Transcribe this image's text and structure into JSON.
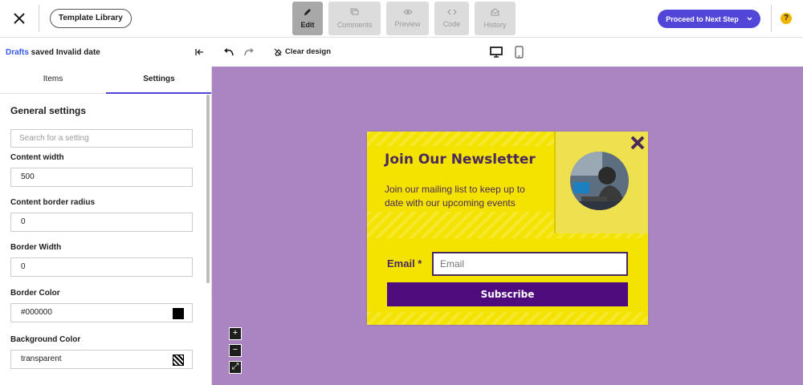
{
  "header": {
    "template_library": "Template Library",
    "modes": [
      {
        "label": "Edit",
        "icon": "pencil-icon",
        "active": true
      },
      {
        "label": "Comments",
        "icon": "comment-icon",
        "active": false
      },
      {
        "label": "Preview",
        "icon": "eye-icon",
        "active": false
      },
      {
        "label": "Code",
        "icon": "code-icon",
        "active": false
      },
      {
        "label": "History",
        "icon": "history-icon",
        "active": false
      }
    ],
    "proceed": "Proceed to Next Step",
    "help": "?"
  },
  "toolbar": {
    "drafts_link": "Drafts",
    "drafts_status": " saved Invalid date",
    "clear_design": "Clear design"
  },
  "sidebar": {
    "tabs": [
      "Items",
      "Settings"
    ],
    "active_tab": "Settings",
    "section_title": "General settings",
    "search_placeholder": "Search for a setting",
    "fields": [
      {
        "label": "Content width",
        "value": "500"
      },
      {
        "label": "Content border radius",
        "value": "0"
      },
      {
        "label": "Border Width",
        "value": "0"
      },
      {
        "label": "Border Color",
        "value": "#000000"
      },
      {
        "label": "Background Color",
        "value": "transparent"
      }
    ]
  },
  "canvas": {
    "zoom": [
      "+",
      "−",
      "⤢"
    ]
  },
  "popup": {
    "title": "Join Our Newsletter",
    "description": "Join our mailing list to keep up to date with our upcoming events",
    "email_label": "Email *",
    "email_placeholder": "Email",
    "button": "Subscribe"
  },
  "colors": {
    "accent": "#5146d8",
    "canvas_bg": "#aa85c2",
    "popup_bg": "#f4e300",
    "popup_text": "#4a2a5b",
    "button_bg": "#4f0c7d"
  }
}
